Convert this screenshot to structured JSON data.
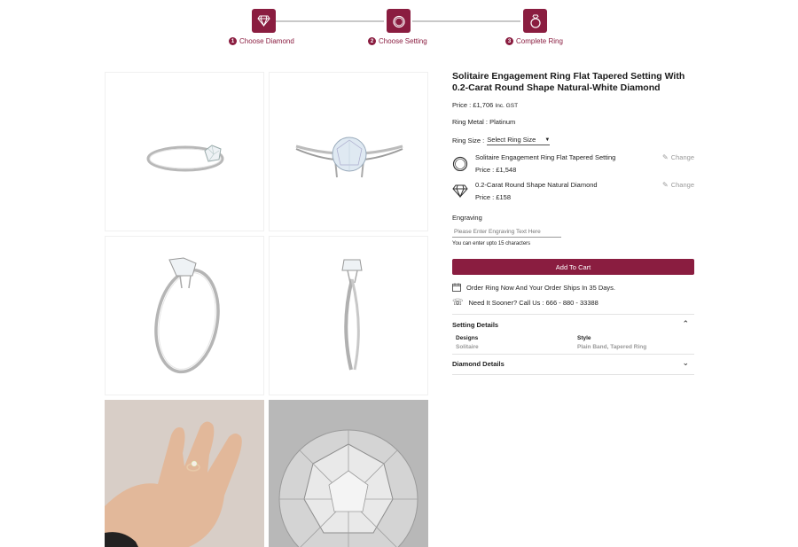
{
  "colors": {
    "accent": "#8a1d40"
  },
  "steps": [
    {
      "num": "1",
      "label": "Choose Diamond",
      "icon": "diamond-icon"
    },
    {
      "num": "2",
      "label": "Choose Setting",
      "icon": "ring-icon"
    },
    {
      "num": "3",
      "label": "Complete Ring",
      "icon": "engagement-ring-icon"
    }
  ],
  "product": {
    "title": "Solitaire Engagement Ring Flat Tapered Setting With 0.2-Carat Round Shape Natural-White Diamond",
    "price_label": "Price : ",
    "price_value": "£1,706",
    "price_suffix": "Inc. GST",
    "metal_label": "Ring Metal : ",
    "metal_value": "Platinum",
    "size_label": "Ring Size :",
    "size_select": "Select Ring Size"
  },
  "components": [
    {
      "name": "Solitaire Engagement Ring Flat Tapered Setting",
      "price": "Price : £1,548",
      "change": "Change",
      "icon": "ring-outline-icon"
    },
    {
      "name": "0.2-Carat Round Shape Natural Diamond",
      "price": "Price : £158",
      "change": "Change",
      "icon": "diamond-outline-icon"
    }
  ],
  "engraving": {
    "label": "Engraving",
    "placeholder": "Please Enter Engraving Text Here",
    "hint": "You can enter upto 15 characters"
  },
  "cart_button": "Add To Cart",
  "shipping_text": "Order Ring Now And Your Order Ships In 35 Days.",
  "phone_text": "Need It Sooner? Call Us : 666 - 880 - 33388",
  "setting_details": {
    "title": "Setting Details",
    "designs_label": "Designs",
    "designs_value": "Solitaire",
    "style_label": "Style",
    "style_value": "Plain Band, Tapered Ring"
  },
  "diamond_details": {
    "title": "Diamond Details"
  }
}
